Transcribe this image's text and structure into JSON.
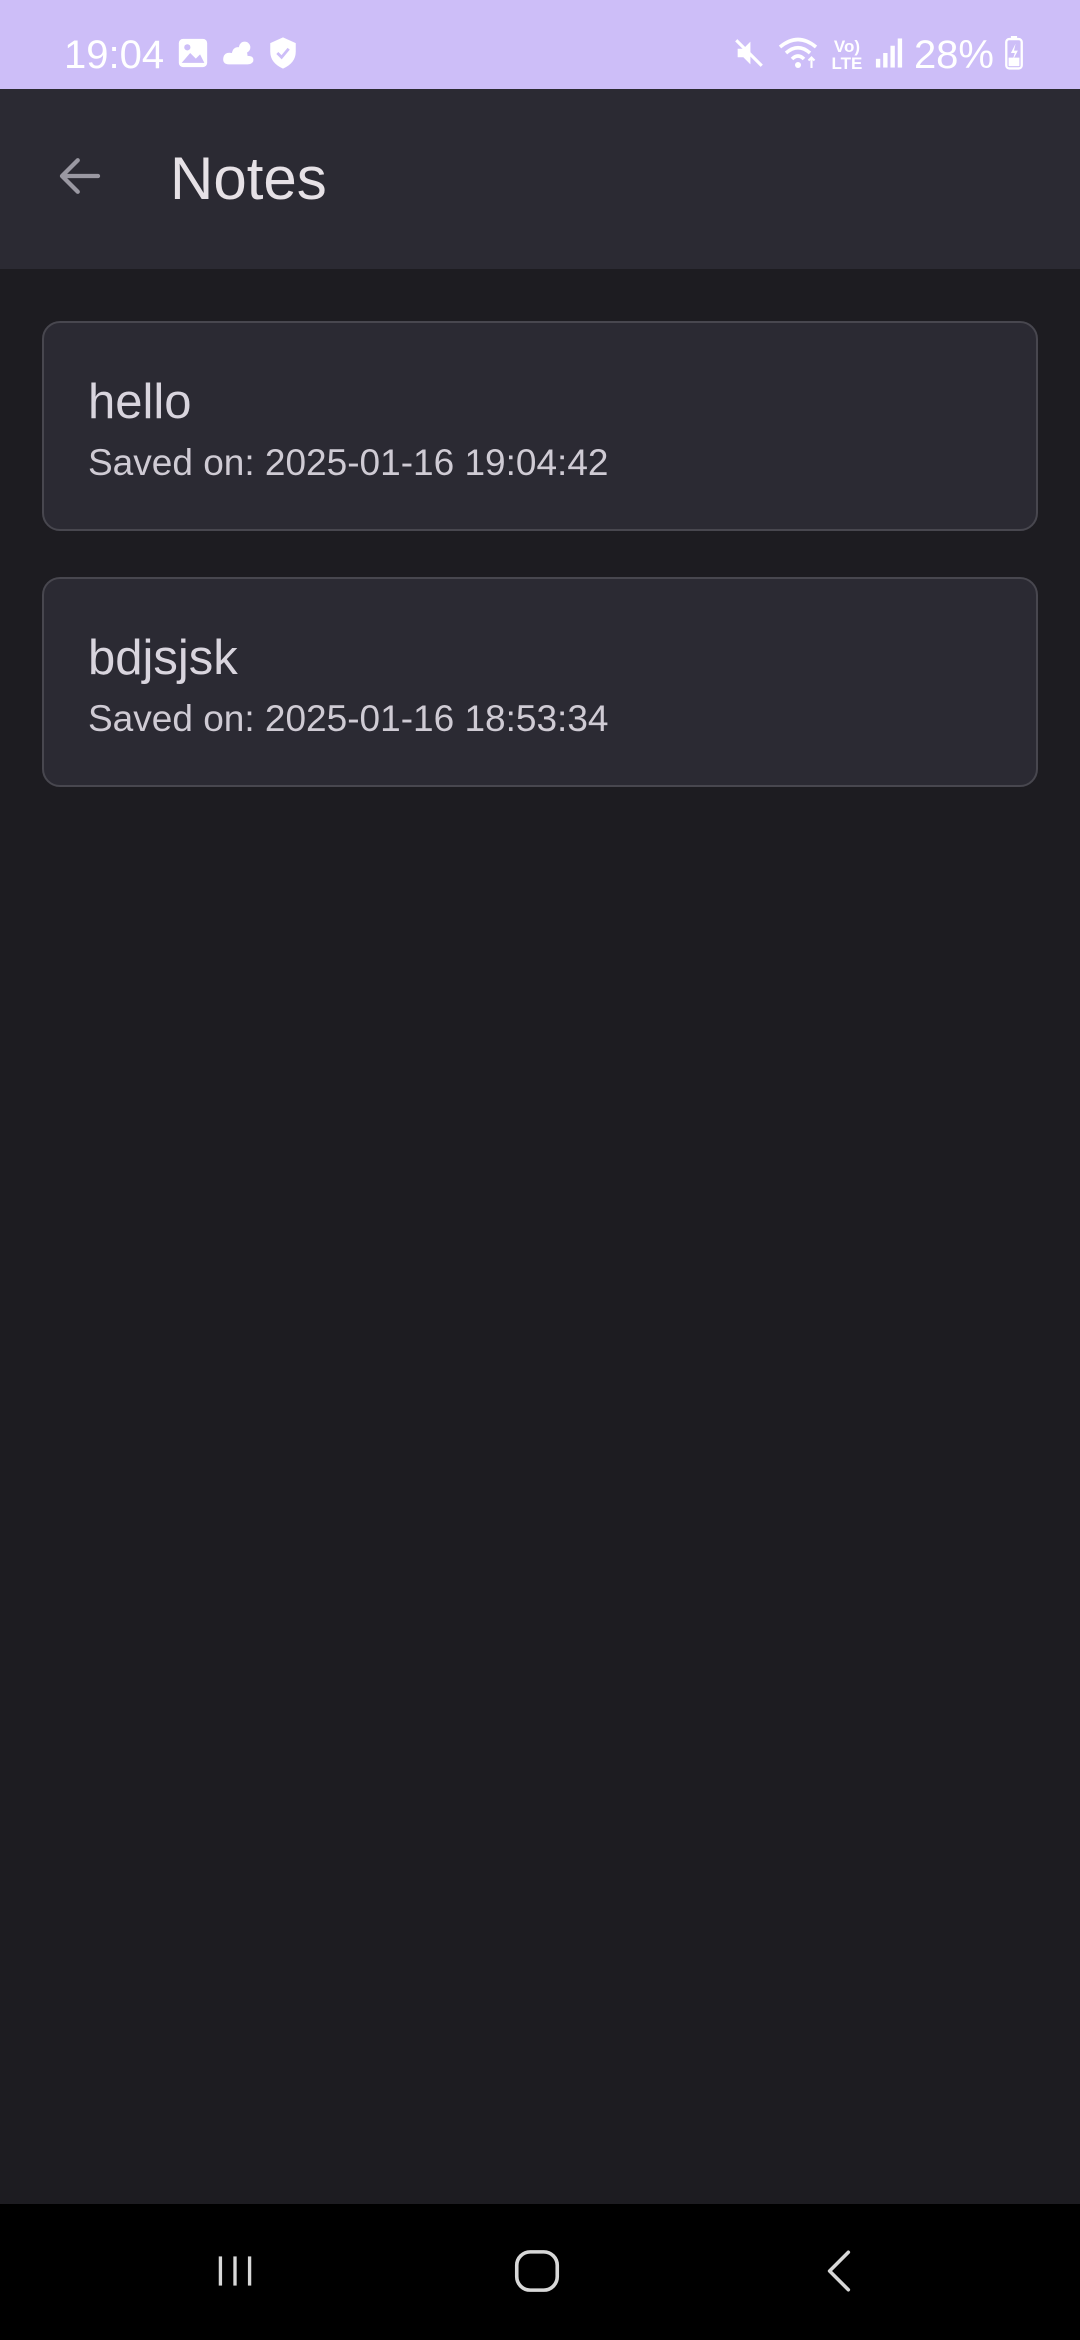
{
  "status_bar": {
    "time": "19:04",
    "battery": "28%",
    "network_badge": "Vo) LTE",
    "left_icons": [
      "gallery-icon",
      "cloud-icon",
      "shield-icon"
    ],
    "right_icons": [
      "mute-icon",
      "wifi-icon",
      "lte-icon",
      "signal-icon",
      "battery-icon"
    ]
  },
  "app_bar": {
    "title": "Notes",
    "back_icon": "arrow-left-icon"
  },
  "notes": [
    {
      "title": "hello",
      "saved": "Saved on: 2025-01-16 19:04:42"
    },
    {
      "title": "bdjsjsk",
      "saved": "Saved on: 2025-01-16 18:53:34"
    }
  ],
  "nav_bar": {
    "icons": [
      "recents-icon",
      "home-icon",
      "back-icon"
    ]
  },
  "colors": {
    "status_bar": "#cdbef8",
    "app_bar": "#2b2a33",
    "background": "#1d1c21",
    "card": "#2b2a33",
    "card_border": "#48474f",
    "text_primary": "#e6e1e6"
  }
}
